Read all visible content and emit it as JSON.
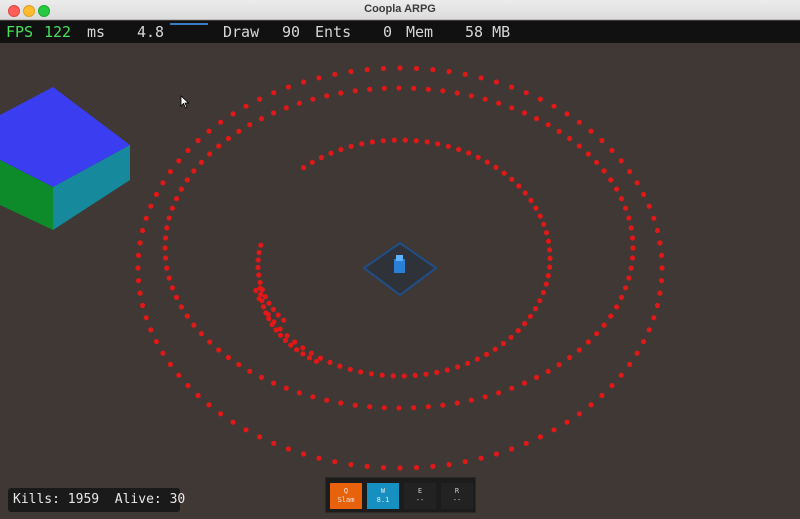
{
  "window": {
    "title": "Coopla ARPG"
  },
  "hud": {
    "fps_label": "FPS",
    "fps_value": "122",
    "ms_label": "ms",
    "ms_value": "4.8",
    "draw_label": "Draw",
    "draw_value": "90",
    "ents_label": "Ents",
    "ents_value": "0",
    "mem_label": "Mem",
    "mem_value": "58 MB"
  },
  "stats": {
    "kills_label": "Kills:",
    "kills_value": "1959",
    "alive_label": "Alive:",
    "alive_value": "30"
  },
  "abilities": [
    {
      "key": "Q",
      "name": "Slam",
      "color": "#e8620c"
    },
    {
      "key": "W",
      "name": "8.1",
      "color": "#1690c0"
    },
    {
      "key": "E",
      "name": "--",
      "color": "#222222"
    },
    {
      "key": "R",
      "name": "--",
      "color": "#222222"
    }
  ],
  "colors": {
    "background": "#3f3835",
    "enemy": "#e01818",
    "player": "#2a7fd6",
    "cube_top": "#3a3df0",
    "cube_left": "#0d8a2a",
    "cube_right": "#168a9c"
  },
  "icons": {
    "cursor": "mouse-pointer-icon"
  }
}
